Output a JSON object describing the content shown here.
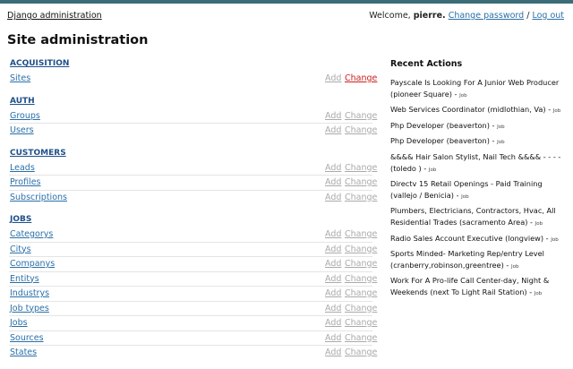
{
  "header": {
    "brand": "Django administration",
    "welcome": "Welcome,",
    "username": "pierre.",
    "change_password": "Change password",
    "separator": "/",
    "logout": "Log out"
  },
  "page_title": "Site administration",
  "apps": [
    {
      "caption": "ACQUISITION",
      "models": [
        {
          "name": "Sites",
          "add": "Add",
          "change": "Change",
          "change_active": true
        }
      ]
    },
    {
      "caption": "AUTH",
      "models": [
        {
          "name": "Groups",
          "add": "Add",
          "change": "Change"
        },
        {
          "name": "Users",
          "add": "Add",
          "change": "Change"
        }
      ]
    },
    {
      "caption": "CUSTOMERS",
      "models": [
        {
          "name": "Leads",
          "add": "Add",
          "change": "Change"
        },
        {
          "name": "Profiles",
          "add": "Add",
          "change": "Change"
        },
        {
          "name": "Subscriptions",
          "add": "Add",
          "change": "Change"
        }
      ]
    },
    {
      "caption": "JOBS",
      "models": [
        {
          "name": "Categorys",
          "add": "Add",
          "change": "Change"
        },
        {
          "name": "Citys",
          "add": "Add",
          "change": "Change"
        },
        {
          "name": "Companys",
          "add": "Add",
          "change": "Change"
        },
        {
          "name": "Entitys",
          "add": "Add",
          "change": "Change"
        },
        {
          "name": "Industrys",
          "add": "Add",
          "change": "Change"
        },
        {
          "name": "Job types",
          "add": "Add",
          "change": "Change"
        },
        {
          "name": "Jobs",
          "add": "Add",
          "change": "Change"
        },
        {
          "name": "Sources",
          "add": "Add",
          "change": "Change"
        },
        {
          "name": "States",
          "add": "Add",
          "change": "Change"
        }
      ]
    }
  ],
  "recent_actions": {
    "title": "Recent Actions",
    "items": [
      {
        "text": "Payscale Is Looking For A Junior Web Producer (pioneer Square)",
        "type": "Job"
      },
      {
        "text": "Web Services Coordinator (midlothian, Va)",
        "type": "Job"
      },
      {
        "text": "Php Developer (beaverton)",
        "type": "Job"
      },
      {
        "text": "Php Developer (beaverton)",
        "type": "Job"
      },
      {
        "text": "&&&& Hair Salon Stylist, Nail Tech &&&& - - - - (toledo )",
        "type": "Job"
      },
      {
        "text": "Directv 15 Retail Openings - Paid Training (vallejo / Benicia)",
        "type": "Job"
      },
      {
        "text": "Plumbers, Electricians, Contractors, Hvac, All Residential Trades (sacramento Area)",
        "type": "Job"
      },
      {
        "text": "Radio Sales Account Executive (longview)",
        "type": "Job"
      },
      {
        "text": "Sports Minded- Marketing Rep/entry Level (cranberry,robinson,greentree)",
        "type": "Job"
      },
      {
        "text": "Work For A Pro-life Call Center-day, Night & Weekends (next To Light Rail Station)",
        "type": "Job"
      }
    ]
  },
  "colors": {
    "topbar": "#3b6d78",
    "link": "#2a6fa8",
    "caption": "#1f4f8a",
    "muted_link": "#aaaaaa",
    "active_change": "#cc1f1f"
  }
}
